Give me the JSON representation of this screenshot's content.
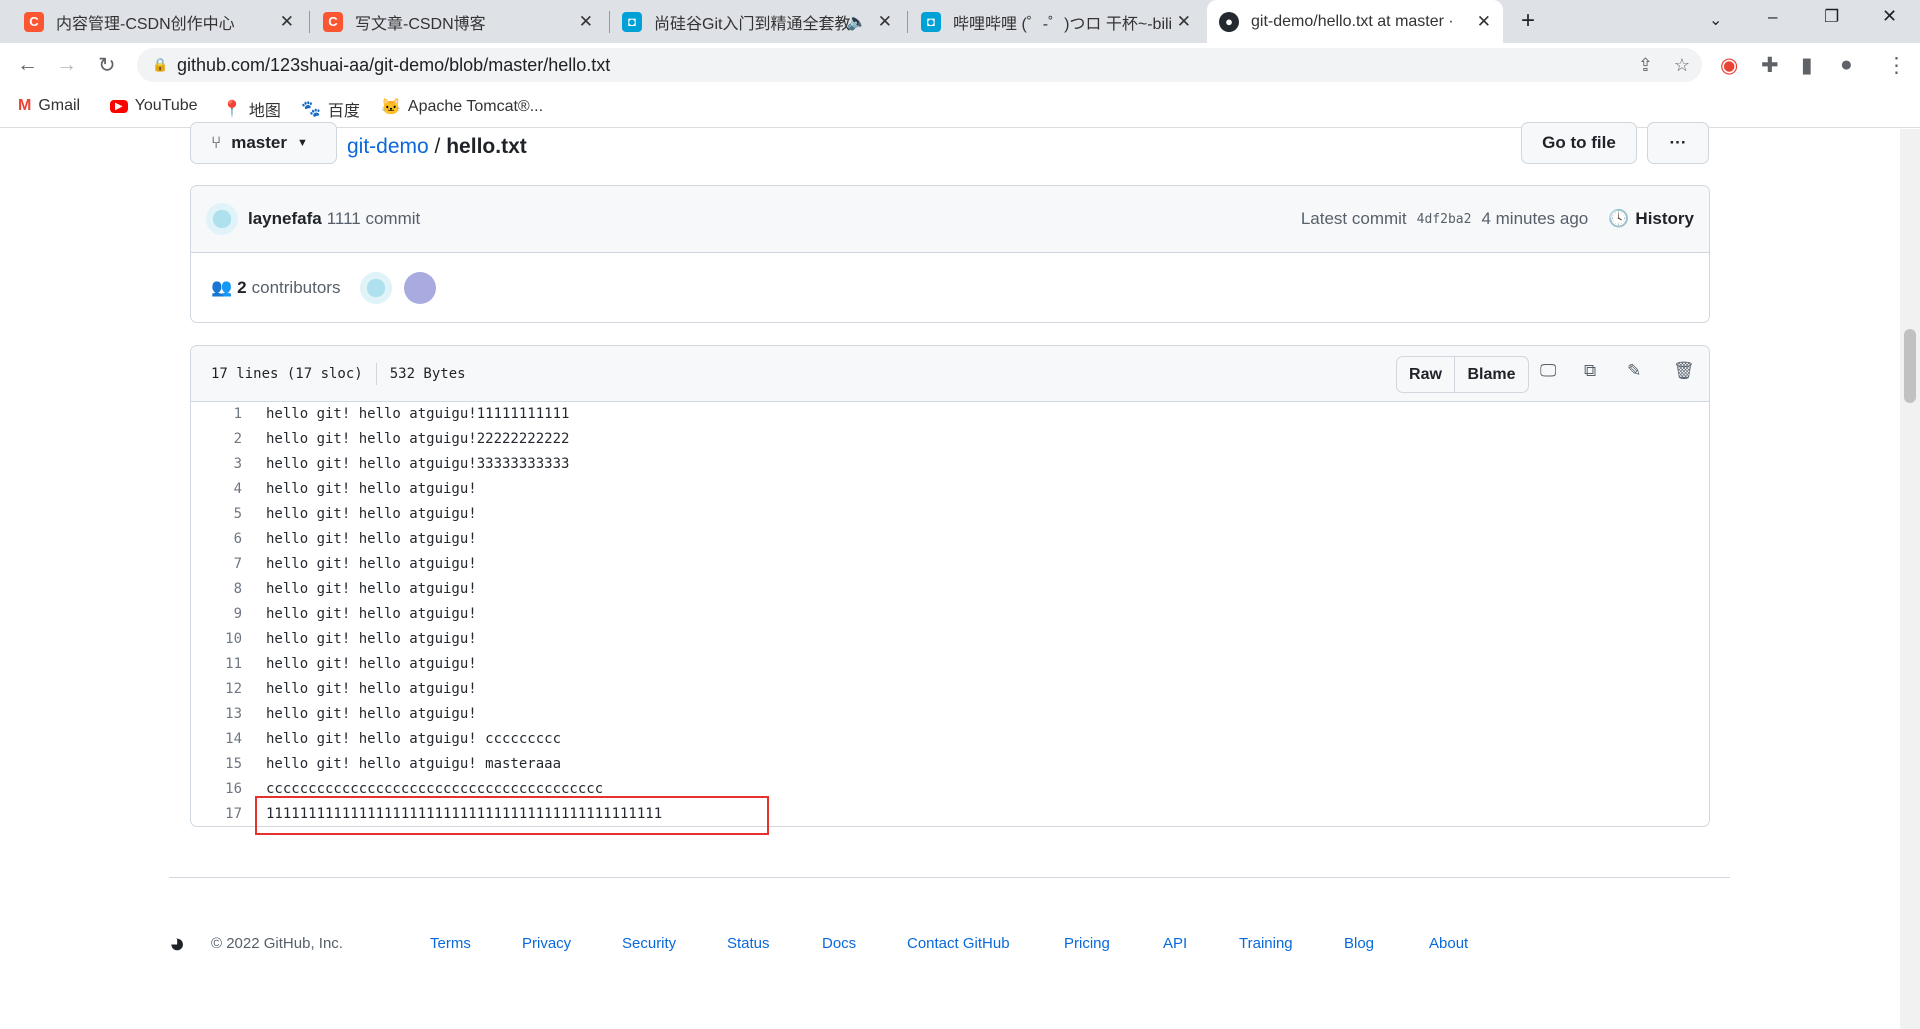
{
  "browser": {
    "tabs": [
      {
        "title": "内容管理-CSDN创作中心",
        "icon": "csdn-icon",
        "color": "#fc5531"
      },
      {
        "title": "写文章-CSDN博客",
        "icon": "csdn-icon",
        "color": "#fc5531"
      },
      {
        "title": "尚硅谷Git入门到精通全套教",
        "icon": "bilibili-icon",
        "color": "#00a1d6"
      },
      {
        "title": "哔哩哔哩 (゜-゜)つロ 干杯~-bili",
        "icon": "bilibili-icon",
        "color": "#00a1d6"
      },
      {
        "title": "git-demo/hello.txt at master ·",
        "icon": "github-icon",
        "color": "#24292f"
      }
    ],
    "url": "github.com/123shuai-aa/git-demo/blob/master/hello.txt",
    "bookmarks": [
      "Gmail",
      "YouTube",
      "地图",
      "百度",
      "Apache Tomcat®..."
    ]
  },
  "repo": {
    "branch": "master",
    "repo_name": "git-demo",
    "separator": "/",
    "file": "hello.txt",
    "go_to_file": "Go to file",
    "more": "···"
  },
  "commit": {
    "author": "laynefafa",
    "message": "1111 commit",
    "latest_label": "Latest commit",
    "sha": "4df2ba2",
    "time": "4 minutes ago",
    "history": "History",
    "contributors_count": "2",
    "contributors_label": "contributors"
  },
  "file": {
    "lines_info": "17 lines (17 sloc)",
    "size": "532 Bytes",
    "raw": "Raw",
    "blame": "Blame",
    "lines": [
      "hello git! hello atguigu!11111111111",
      "hello git! hello atguigu!22222222222",
      "hello git! hello atguigu!33333333333",
      "hello git! hello atguigu!",
      "hello git! hello atguigu!",
      "hello git! hello atguigu!",
      "hello git! hello atguigu!",
      "hello git! hello atguigu!",
      "hello git! hello atguigu!",
      "hello git! hello atguigu!",
      "hello git! hello atguigu!",
      "hello git! hello atguigu!",
      "hello git! hello atguigu!",
      "hello git! hello atguigu! ccccccccc",
      "hello git! hello atguigu! masteraaa",
      "cccccccccccccccccccccccccccccccccccccccc",
      "11111111111111111111111111111111111111111111111"
    ],
    "highlight_color": "#e5322d"
  },
  "footer": {
    "copyright": "© 2022 GitHub, Inc.",
    "links": [
      "Terms",
      "Privacy",
      "Security",
      "Status",
      "Docs",
      "Contact GitHub",
      "Pricing",
      "API",
      "Training",
      "Blog",
      "About"
    ]
  }
}
